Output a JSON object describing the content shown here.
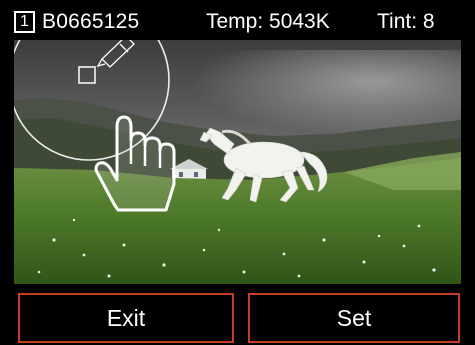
{
  "header": {
    "card_number": "1",
    "file_name": "B0665125",
    "temperature": "Temp: 5043K",
    "tint": "Tint: 8"
  },
  "softkeys": {
    "exit_label": "Exit",
    "set_label": "Set"
  },
  "icons": {
    "picker_circle": "white-balance-picker-circle",
    "eyedropper": "eyedropper-icon",
    "sample_square": "sample-target-square",
    "pointer": "hand-pointer-icon"
  },
  "colors": {
    "background": "#000000",
    "text": "#ffffff",
    "softkey_border": "#c4401f"
  }
}
